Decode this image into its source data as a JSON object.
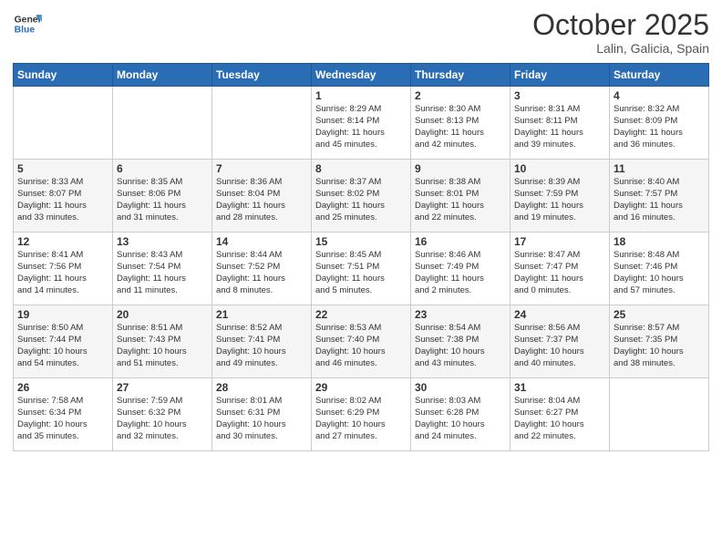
{
  "header": {
    "logo_general": "General",
    "logo_blue": "Blue",
    "month": "October 2025",
    "location": "Lalin, Galicia, Spain"
  },
  "days_of_week": [
    "Sunday",
    "Monday",
    "Tuesday",
    "Wednesday",
    "Thursday",
    "Friday",
    "Saturday"
  ],
  "weeks": [
    [
      {
        "day": "",
        "info": ""
      },
      {
        "day": "",
        "info": ""
      },
      {
        "day": "",
        "info": ""
      },
      {
        "day": "1",
        "info": "Sunrise: 8:29 AM\nSunset: 8:14 PM\nDaylight: 11 hours\nand 45 minutes."
      },
      {
        "day": "2",
        "info": "Sunrise: 8:30 AM\nSunset: 8:13 PM\nDaylight: 11 hours\nand 42 minutes."
      },
      {
        "day": "3",
        "info": "Sunrise: 8:31 AM\nSunset: 8:11 PM\nDaylight: 11 hours\nand 39 minutes."
      },
      {
        "day": "4",
        "info": "Sunrise: 8:32 AM\nSunset: 8:09 PM\nDaylight: 11 hours\nand 36 minutes."
      }
    ],
    [
      {
        "day": "5",
        "info": "Sunrise: 8:33 AM\nSunset: 8:07 PM\nDaylight: 11 hours\nand 33 minutes."
      },
      {
        "day": "6",
        "info": "Sunrise: 8:35 AM\nSunset: 8:06 PM\nDaylight: 11 hours\nand 31 minutes."
      },
      {
        "day": "7",
        "info": "Sunrise: 8:36 AM\nSunset: 8:04 PM\nDaylight: 11 hours\nand 28 minutes."
      },
      {
        "day": "8",
        "info": "Sunrise: 8:37 AM\nSunset: 8:02 PM\nDaylight: 11 hours\nand 25 minutes."
      },
      {
        "day": "9",
        "info": "Sunrise: 8:38 AM\nSunset: 8:01 PM\nDaylight: 11 hours\nand 22 minutes."
      },
      {
        "day": "10",
        "info": "Sunrise: 8:39 AM\nSunset: 7:59 PM\nDaylight: 11 hours\nand 19 minutes."
      },
      {
        "day": "11",
        "info": "Sunrise: 8:40 AM\nSunset: 7:57 PM\nDaylight: 11 hours\nand 16 minutes."
      }
    ],
    [
      {
        "day": "12",
        "info": "Sunrise: 8:41 AM\nSunset: 7:56 PM\nDaylight: 11 hours\nand 14 minutes."
      },
      {
        "day": "13",
        "info": "Sunrise: 8:43 AM\nSunset: 7:54 PM\nDaylight: 11 hours\nand 11 minutes."
      },
      {
        "day": "14",
        "info": "Sunrise: 8:44 AM\nSunset: 7:52 PM\nDaylight: 11 hours\nand 8 minutes."
      },
      {
        "day": "15",
        "info": "Sunrise: 8:45 AM\nSunset: 7:51 PM\nDaylight: 11 hours\nand 5 minutes."
      },
      {
        "day": "16",
        "info": "Sunrise: 8:46 AM\nSunset: 7:49 PM\nDaylight: 11 hours\nand 2 minutes."
      },
      {
        "day": "17",
        "info": "Sunrise: 8:47 AM\nSunset: 7:47 PM\nDaylight: 11 hours\nand 0 minutes."
      },
      {
        "day": "18",
        "info": "Sunrise: 8:48 AM\nSunset: 7:46 PM\nDaylight: 10 hours\nand 57 minutes."
      }
    ],
    [
      {
        "day": "19",
        "info": "Sunrise: 8:50 AM\nSunset: 7:44 PM\nDaylight: 10 hours\nand 54 minutes."
      },
      {
        "day": "20",
        "info": "Sunrise: 8:51 AM\nSunset: 7:43 PM\nDaylight: 10 hours\nand 51 minutes."
      },
      {
        "day": "21",
        "info": "Sunrise: 8:52 AM\nSunset: 7:41 PM\nDaylight: 10 hours\nand 49 minutes."
      },
      {
        "day": "22",
        "info": "Sunrise: 8:53 AM\nSunset: 7:40 PM\nDaylight: 10 hours\nand 46 minutes."
      },
      {
        "day": "23",
        "info": "Sunrise: 8:54 AM\nSunset: 7:38 PM\nDaylight: 10 hours\nand 43 minutes."
      },
      {
        "day": "24",
        "info": "Sunrise: 8:56 AM\nSunset: 7:37 PM\nDaylight: 10 hours\nand 40 minutes."
      },
      {
        "day": "25",
        "info": "Sunrise: 8:57 AM\nSunset: 7:35 PM\nDaylight: 10 hours\nand 38 minutes."
      }
    ],
    [
      {
        "day": "26",
        "info": "Sunrise: 7:58 AM\nSunset: 6:34 PM\nDaylight: 10 hours\nand 35 minutes."
      },
      {
        "day": "27",
        "info": "Sunrise: 7:59 AM\nSunset: 6:32 PM\nDaylight: 10 hours\nand 32 minutes."
      },
      {
        "day": "28",
        "info": "Sunrise: 8:01 AM\nSunset: 6:31 PM\nDaylight: 10 hours\nand 30 minutes."
      },
      {
        "day": "29",
        "info": "Sunrise: 8:02 AM\nSunset: 6:29 PM\nDaylight: 10 hours\nand 27 minutes."
      },
      {
        "day": "30",
        "info": "Sunrise: 8:03 AM\nSunset: 6:28 PM\nDaylight: 10 hours\nand 24 minutes."
      },
      {
        "day": "31",
        "info": "Sunrise: 8:04 AM\nSunset: 6:27 PM\nDaylight: 10 hours\nand 22 minutes."
      },
      {
        "day": "",
        "info": ""
      }
    ]
  ]
}
